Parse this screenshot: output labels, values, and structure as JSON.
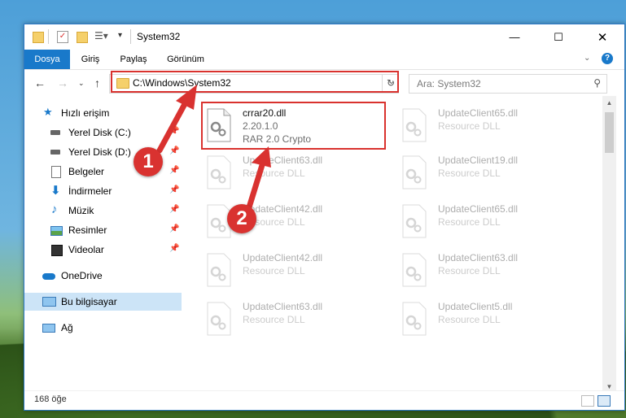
{
  "window": {
    "title": "System32"
  },
  "ribbon": {
    "tabs": [
      "Dosya",
      "Giriş",
      "Paylaş",
      "Görünüm"
    ]
  },
  "address": {
    "path": "C:\\Windows\\System32"
  },
  "search": {
    "placeholder": "Ara: System32"
  },
  "nav": {
    "items": [
      {
        "label": "Hızlı erişim",
        "icon": "star-icon",
        "pinned": false
      },
      {
        "label": "Yerel Disk (C:)",
        "icon": "drive-icon",
        "pinned": true
      },
      {
        "label": "Yerel Disk (D:)",
        "icon": "drive-icon",
        "pinned": true
      },
      {
        "label": "Belgeler",
        "icon": "document-icon",
        "pinned": true
      },
      {
        "label": "İndirmeler",
        "icon": "download-icon",
        "pinned": true
      },
      {
        "label": "Müzik",
        "icon": "music-icon",
        "pinned": true
      },
      {
        "label": "Resimler",
        "icon": "picture-icon",
        "pinned": true
      },
      {
        "label": "Videolar",
        "icon": "video-icon",
        "pinned": true
      },
      {
        "label": "OneDrive",
        "icon": "cloud-icon",
        "pinned": false
      },
      {
        "label": "Bu bilgisayar",
        "icon": "computer-icon",
        "pinned": false,
        "selected": true
      },
      {
        "label": "Ağ",
        "icon": "network-icon",
        "pinned": false
      }
    ]
  },
  "files": [
    {
      "name": "crrar20.dll",
      "line2": "2.20.1.0",
      "line3": "RAR 2.0 Crypto",
      "highlighted": true
    },
    {
      "name": "UpdateClient65.dll",
      "line2": "Resource DLL"
    },
    {
      "name": "UpdateClient63.dll",
      "line2": "Resource DLL"
    },
    {
      "name": "UpdateClient19.dll",
      "line2": "Resource DLL"
    },
    {
      "name": "UpdateClient42.dll",
      "line2": "Resource DLL"
    },
    {
      "name": "UpdateClient65.dll",
      "line2": "Resource DLL"
    },
    {
      "name": "UpdateClient42.dll",
      "line2": "Resource DLL"
    },
    {
      "name": "UpdateClient63.dll",
      "line2": "Resource DLL"
    },
    {
      "name": "UpdateClient63.dll",
      "line2": "Resource DLL"
    },
    {
      "name": "UpdateClient5.dll",
      "line2": "Resource DLL"
    }
  ],
  "status": {
    "count": "168 öğe"
  },
  "annotations": {
    "badge1": "1",
    "badge2": "2",
    "color": "#d9322e"
  },
  "colors": {
    "accent": "#1979ca",
    "selection": "#cce4f7"
  }
}
